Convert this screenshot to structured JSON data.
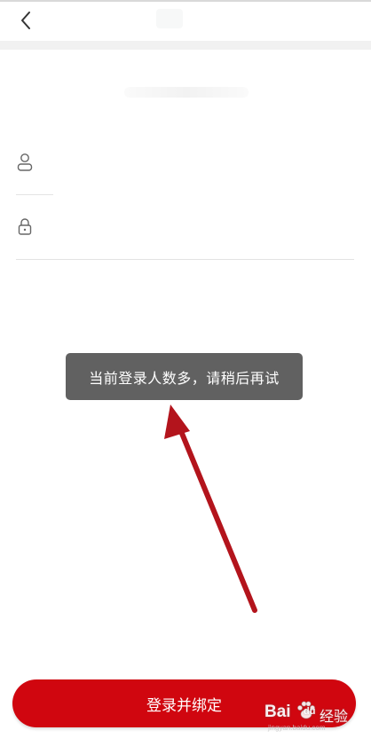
{
  "toast": {
    "message": "当前登录人数多，请稍后再试"
  },
  "login": {
    "button_label": "登录并绑定"
  },
  "fields": {
    "username_placeholder": "",
    "password_placeholder": ""
  },
  "watermark": {
    "brand_left": "Bai",
    "brand_right": "du",
    "label": "经验",
    "url": "jingyan.baidu.com"
  },
  "colors": {
    "primary": "#d0060f",
    "toast_bg": "#585858",
    "annotation_arrow": "#b3141c"
  },
  "icons": {
    "back": "chevron-left-icon",
    "user": "user-icon",
    "lock": "lock-icon",
    "paw": "baidu-paw-icon"
  }
}
